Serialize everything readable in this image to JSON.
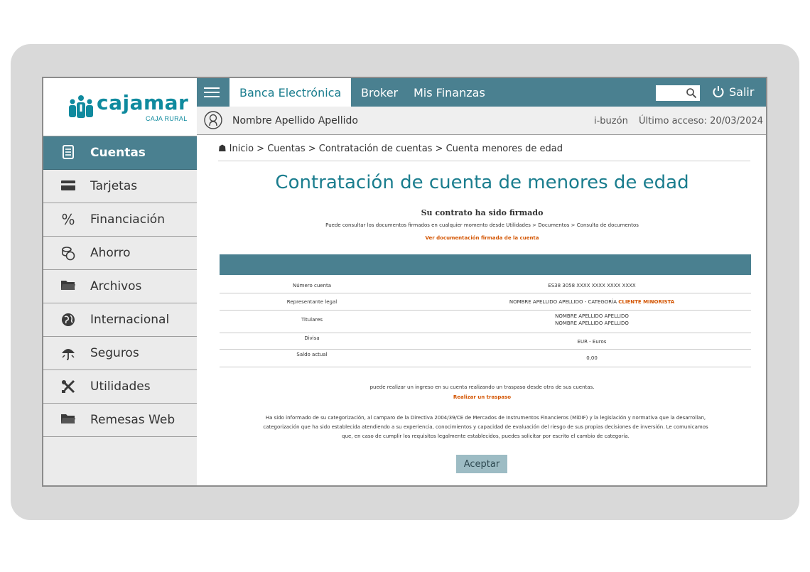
{
  "brand": {
    "name": "cajamar",
    "sub": "CAJA RURAL",
    "color": "#0f8a9e"
  },
  "sidebar": {
    "items": [
      {
        "label": "Cuentas",
        "icon": "document-icon",
        "active": true
      },
      {
        "label": "Tarjetas",
        "icon": "card-icon"
      },
      {
        "label": "Financiación",
        "icon": "percent-icon"
      },
      {
        "label": "Ahorro",
        "icon": "coins-icon"
      },
      {
        "label": "Archivos",
        "icon": "folder-icon"
      },
      {
        "label": "Internacional",
        "icon": "globe-icon"
      },
      {
        "label": "Seguros",
        "icon": "umbrella-icon"
      },
      {
        "label": "Utilidades",
        "icon": "tools-icon"
      },
      {
        "label": "Remesas Web",
        "icon": "folder-icon"
      }
    ]
  },
  "topbar": {
    "tabs": [
      {
        "label": "Banca Electrónica",
        "active": true
      },
      {
        "label": "Broker"
      },
      {
        "label": "Mis Finanzas"
      }
    ],
    "logout_label": "Salir"
  },
  "userbar": {
    "name": "Nombre Apellido Apellido",
    "ibuzon": "i-buzón",
    "last_access": "Último acceso: 20/03/2024"
  },
  "breadcrumb": "Inicio > Cuentas > Contratación de cuentas > Cuenta menores de edad",
  "main": {
    "title": "Contratación de cuenta de menores de edad",
    "subtitle": "Su contrato ha sido firmado",
    "hint": "Puede consultar los documentos firmados en cualquier momento desde Utilidades > Documentos > Consulta de documentos",
    "doc_link": "Ver documentación firmada de la cuenta",
    "rows": [
      {
        "key": "Número cuenta",
        "value": "ES38 3058 XXXX XXXX XXXX XXXX"
      },
      {
        "key": "Representante legal",
        "value": "NOMBRE APELLIDO APELLIDO - CATEGORÍA",
        "highlight": "CLIENTE MINORISTA"
      },
      {
        "key": "Titulares",
        "value": "NOMBRE APELLIDO APELLIDO",
        "value2": "NOMBRE APELLIDO APELLIDO"
      },
      {
        "key": "Divisa",
        "value": "EUR - Euros"
      },
      {
        "key": "Saldo actual",
        "value": "0,00"
      }
    ],
    "transfer_text": "puede realizar un ingreso en su cuenta realizando un traspaso desde otra de sus cuentas.",
    "transfer_link": "Realizar un traspaso",
    "legal_1": "Ha sido informado de su categorización, al camparo de la Directiva 2004/39/CE de Mercados de Instrumentos Financieros (MiDIF) y la legislación y normativa que la desarrollan,",
    "legal_2": "categorización que ha sido establecida atendiendo a su experiencia, conocimientos y capacidad de evaluación del riesgo de sus propias decisiones de inversión. Le comunicamos",
    "legal_3": "que, en caso de cumplir los requisitos legalmente establecidos, puedes solicitar por escrito el cambio de categoría.",
    "accept_label": "Aceptar"
  },
  "colors": {
    "primary": "#4a8090",
    "accent": "#1a7d8e",
    "link": "#d35400"
  }
}
